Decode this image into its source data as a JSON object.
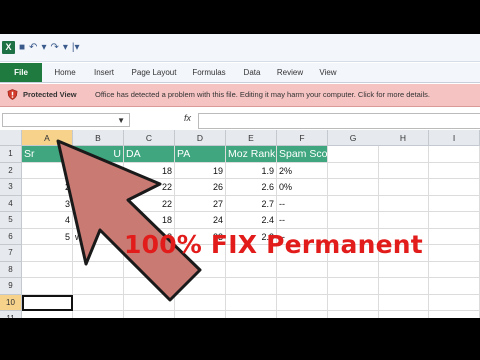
{
  "qat": {
    "app_icon": "X",
    "icons": [
      "save-icon",
      "undo-icon",
      "redo-icon",
      "customize-icon"
    ]
  },
  "ribbon": {
    "tabs": [
      "File",
      "Home",
      "Insert",
      "Page Layout",
      "Formulas",
      "Data",
      "Review",
      "View"
    ]
  },
  "protected_view": {
    "title": "Protected View",
    "message": "Office has detected a problem with this file. Editing it may harm your computer. Click for more details."
  },
  "formula_bar": {
    "fx": "fx",
    "name_box": "▼"
  },
  "columns": [
    "A",
    "B",
    "C",
    "D",
    "E",
    "F",
    "G",
    "H",
    "I"
  ],
  "rows": [
    "1",
    "2",
    "3",
    "4",
    "5",
    "6",
    "7",
    "8",
    "9",
    "10",
    "11"
  ],
  "sheet": {
    "headers": [
      "Sr",
      "",
      "DA",
      "PA",
      "Moz Rank",
      "Spam Score"
    ],
    "header_partials": {
      "B": "U"
    },
    "data": [
      {
        "sr": "1",
        "url": "",
        "da": "18",
        "pa": "19",
        "moz": "1.9",
        "spam": "2%"
      },
      {
        "sr": "2",
        "url": "",
        "da": "22",
        "pa": "26",
        "moz": "2.6",
        "spam": "0%"
      },
      {
        "sr": "3",
        "url": "ad",
        "da": "22",
        "pa": "27",
        "moz": "2.7",
        "spam": "--"
      },
      {
        "sr": "4",
        "url": "www",
        "da": "18",
        "pa": "24",
        "moz": "2.4",
        "spam": "--"
      },
      {
        "sr": "5",
        "url": "www",
        "da": "18",
        "pa": "23",
        "moz": "2.3",
        "spam": "--"
      }
    ]
  },
  "overlay": {
    "text": "100% FIX Permanent",
    "arrow_color": "#c97a73"
  }
}
